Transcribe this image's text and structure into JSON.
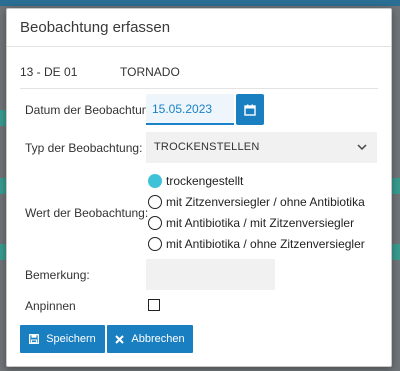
{
  "dialog": {
    "title": "Beobachtung erfassen",
    "record_id": "13 - DE 01",
    "record_name": "TORNADO"
  },
  "form": {
    "date_label": "Datum der Beobachtung:",
    "date_value": "15.05.2023",
    "type_label": "Typ der Beobachtung:",
    "type_value": "TROCKENSTELLEN",
    "value_label": "Wert der Beobachtung:",
    "options": [
      {
        "label": "trockengestellt",
        "checked": true
      },
      {
        "label": "mit Zitzenversiegler / ohne Antibiotika",
        "checked": false
      },
      {
        "label": "mit Antibiotika / mit Zitzenversiegler",
        "checked": false
      },
      {
        "label": "mit Antibiotika / ohne Zitzenversiegler",
        "checked": false
      }
    ],
    "remark_label": "Bemerkung:",
    "remark_value": "",
    "pin_label": "Anpinnen",
    "pin_checked": false
  },
  "buttons": {
    "save_label": "Speichern",
    "cancel_label": "Abbrechen"
  },
  "colors": {
    "primary": "#1a7fc1",
    "radio_selected": "#3ec2d8",
    "field_bg": "#f1f1f1"
  },
  "icons": {
    "calendar": "calendar-icon",
    "chevron": "chevron-down-icon",
    "save": "save-icon",
    "cancel": "close-icon"
  }
}
